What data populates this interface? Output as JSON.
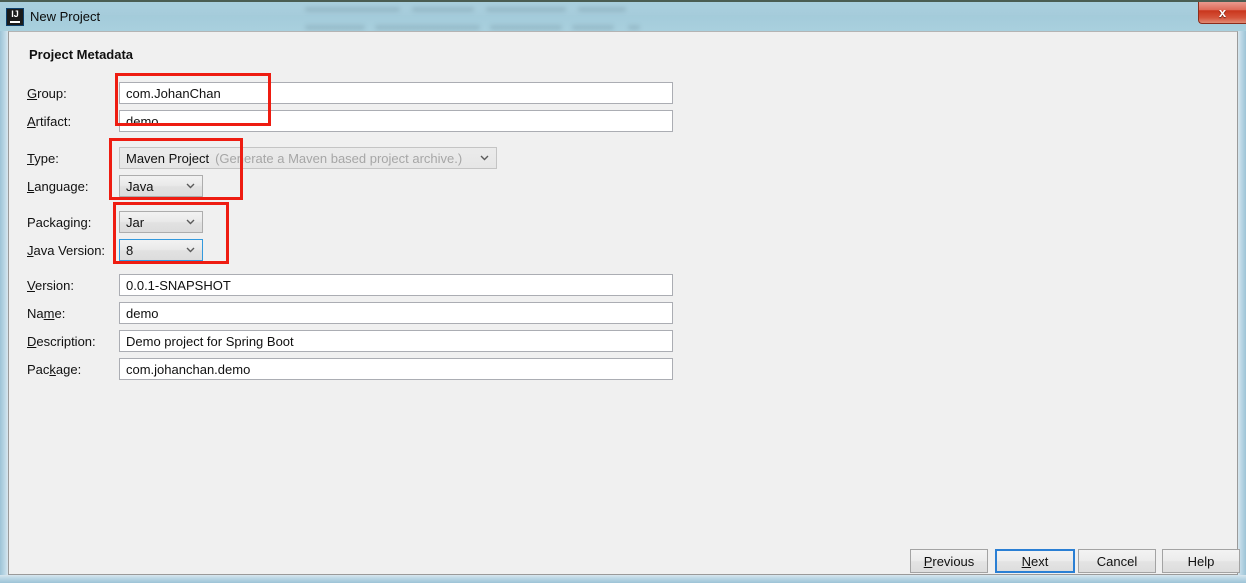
{
  "window": {
    "title": "New Project",
    "app_icon": "intellij-idea-icon",
    "close_label": "x"
  },
  "dialog": {
    "section_title": "Project Metadata",
    "fields": [
      {
        "label": "Group:",
        "mnemonic": "G",
        "type": "text",
        "value": "com.JohanChan"
      },
      {
        "label": "Artifact:",
        "mnemonic": "A",
        "type": "text",
        "value": "demo"
      },
      {
        "label": "Type:",
        "mnemonic": "T",
        "type": "combo",
        "value": "Maven Project",
        "hint": "(Generate a Maven based project archive.)"
      },
      {
        "label": "Language:",
        "mnemonic": "L",
        "type": "combo",
        "value": "Java"
      },
      {
        "label": "Packaging:",
        "mnemonic": "g",
        "type": "combo",
        "value": "Jar"
      },
      {
        "label": "Java Version:",
        "mnemonic": "J",
        "type": "combo",
        "value": "8",
        "focused": true
      },
      {
        "label": "Version:",
        "mnemonic": "V",
        "type": "text",
        "value": "0.0.1-SNAPSHOT"
      },
      {
        "label": "Name:",
        "mnemonic": "m",
        "type": "text",
        "value": "demo"
      },
      {
        "label": "Description:",
        "mnemonic": "D",
        "type": "text",
        "value": "Demo project for Spring Boot"
      },
      {
        "label": "Package:",
        "mnemonic": "k",
        "type": "text",
        "value": "com.johanchan.demo"
      }
    ],
    "buttons": [
      {
        "label": "Previous",
        "mnemonic": "P",
        "default": false
      },
      {
        "label": "Next",
        "mnemonic": "N",
        "default": true
      },
      {
        "label": "Cancel",
        "mnemonic": "",
        "default": false
      },
      {
        "label": "Help",
        "mnemonic": "",
        "default": false
      }
    ]
  },
  "annotations": {
    "color": "#ee1c11",
    "boxes": [
      {
        "name": "group-artifact-highlight"
      },
      {
        "name": "type-language-highlight"
      },
      {
        "name": "packaging-javaversion-highlight"
      }
    ]
  }
}
